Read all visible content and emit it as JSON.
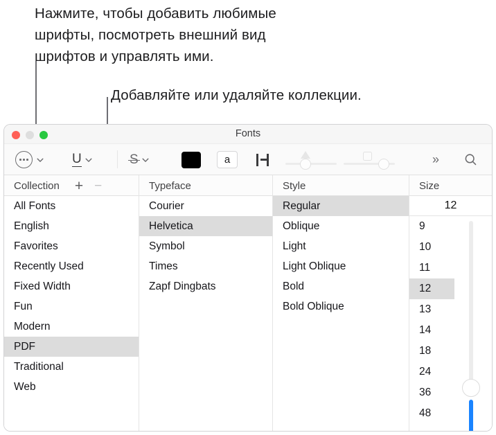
{
  "callouts": {
    "top": "Нажмите, чтобы добавить любимые\nшрифты, посмотреть внешний вид\nшрифтов и управлять ими.",
    "second": "Добавляйте или удаляйте коллекции."
  },
  "window": {
    "title": "Fonts",
    "traffic_lights": [
      {
        "name": "close",
        "color": "#ff6057"
      },
      {
        "name": "minimize",
        "color": "#dedede"
      },
      {
        "name": "zoom",
        "color": "#28c840"
      }
    ]
  },
  "toolbar": {
    "actions_label": "⋯",
    "underline_label": "U",
    "strikethrough_label": "S",
    "text_color_swatch": "#000000",
    "background_color_label": "a",
    "kerning_label": "",
    "shadow_opacity_value": 40,
    "shadow_offset_value": 72,
    "more_label": "»",
    "search_label": ""
  },
  "columns": {
    "collection": "Collection",
    "typeface": "Typeface",
    "style": "Style",
    "size": "Size",
    "add_label": "+",
    "remove_label": "−"
  },
  "collections": {
    "items": [
      "All Fonts",
      "English",
      "Favorites",
      "Recently Used",
      "Fixed Width",
      "Fun",
      "Modern",
      "PDF",
      "Traditional",
      "Web"
    ],
    "selected": "PDF"
  },
  "typefaces": {
    "items": [
      "Courier",
      "Helvetica",
      "Symbol",
      "Times",
      "Zapf Dingbats"
    ],
    "selected": "Helvetica"
  },
  "styles": {
    "items": [
      "Regular",
      "Oblique",
      "Light",
      "Light Oblique",
      "Bold",
      "Bold Oblique"
    ],
    "selected": "Regular"
  },
  "sizes": {
    "field_value": "12",
    "items": [
      "9",
      "10",
      "11",
      "12",
      "13",
      "14",
      "18",
      "24",
      "36",
      "48"
    ],
    "selected": "12",
    "slider_accent": "#1a84ff"
  }
}
